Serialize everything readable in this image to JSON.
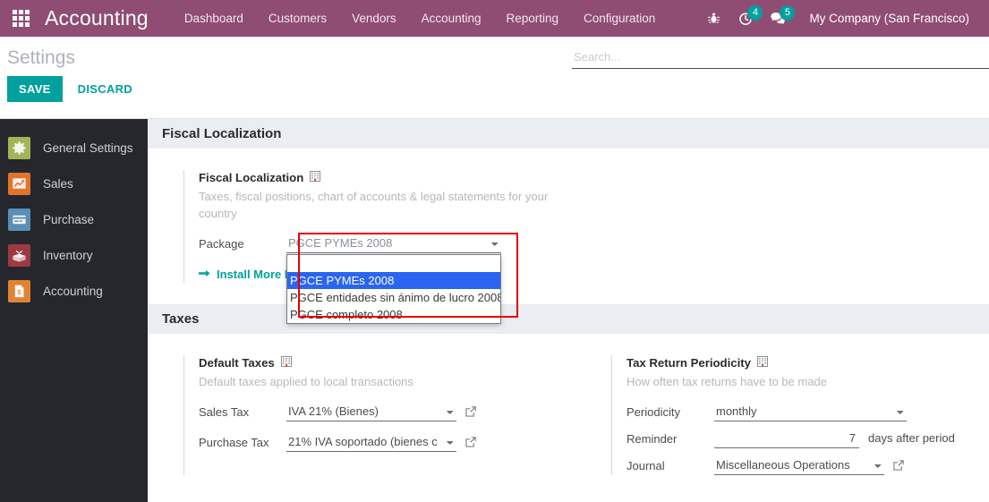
{
  "navbar": {
    "apps_icon": "apps-grid-icon",
    "brand": "Accounting",
    "menu": [
      {
        "label": "Dashboard"
      },
      {
        "label": "Customers"
      },
      {
        "label": "Vendors"
      },
      {
        "label": "Accounting"
      },
      {
        "label": "Reporting"
      },
      {
        "label": "Configuration"
      }
    ],
    "bug_icon": "bug-icon",
    "activities": {
      "icon": "clock-activity-icon",
      "count": "4"
    },
    "messages": {
      "icon": "chat-bubble-icon",
      "count": "5"
    },
    "company": "My Company (San Francisco)",
    "background_color": "#8f4d74",
    "badge_color": "#00a09d"
  },
  "control_panel": {
    "title": "Settings",
    "save_label": "SAVE",
    "discard_label": "DISCARD",
    "search_placeholder": "Search...",
    "search_value": "",
    "save_color": "#00a09d"
  },
  "sidebar": {
    "items": [
      {
        "label": "General Settings",
        "icon": "gear-icon",
        "color": "#a2b556"
      },
      {
        "label": "Sales",
        "icon": "chart-line-icon",
        "color": "#e0742f"
      },
      {
        "label": "Purchase",
        "icon": "credit-card-icon",
        "color": "#5b8fb5"
      },
      {
        "label": "Inventory",
        "icon": "open-box-icon",
        "color": "#9c3a42"
      },
      {
        "label": "Accounting",
        "icon": "invoice-icon",
        "color": "#e08434"
      }
    ]
  },
  "sections": {
    "fiscal_localization": {
      "header": "Fiscal Localization",
      "setting_title": "Fiscal Localization",
      "company_icon": "building-icon",
      "description": "Taxes, fiscal positions, chart of accounts & legal statements for your country",
      "package_label": "Package",
      "package_value": "PGCE PYMEs 2008",
      "install_link": "Install More P",
      "install_link_icon": "arrow-right-icon",
      "dropdown": {
        "open": true,
        "options": [
          "",
          "PGCE PYMEs 2008",
          "PGCE entidades sin ánimo de lucro 2008",
          "PGCE completo 2008"
        ],
        "selected_index": 1,
        "highlight_color": "#2a65f0",
        "annotation_color": "#e70000"
      }
    },
    "taxes": {
      "header": "Taxes",
      "default_taxes": {
        "setting_title": "Default Taxes",
        "company_icon": "building-icon",
        "description": "Default taxes applied to local transactions",
        "fields": [
          {
            "label": "Sales Tax",
            "value": "IVA 21% (Bienes)",
            "external_link_icon": "external-link-icon"
          },
          {
            "label": "Purchase Tax",
            "value": "21% IVA soportado (bienes c",
            "external_link_icon": "external-link-icon"
          }
        ]
      },
      "tax_return_periodicity": {
        "setting_title": "Tax Return Periodicity",
        "company_icon": "building-icon",
        "description": "How often tax returns have to be made",
        "periodicity_label": "Periodicity",
        "periodicity_value": "monthly",
        "reminder_label": "Reminder",
        "reminder_value": "7",
        "reminder_suffix": "days after period",
        "journal_label": "Journal",
        "journal_value": "Miscellaneous Operations",
        "journal_external_link_icon": "external-link-icon"
      }
    }
  }
}
